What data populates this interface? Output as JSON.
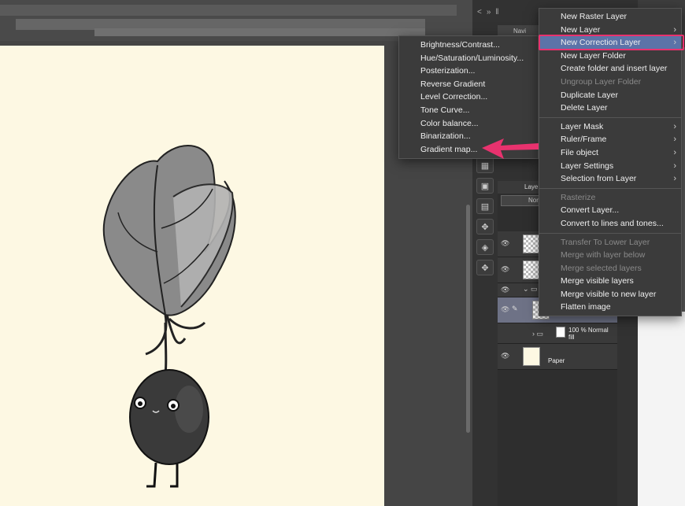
{
  "app": {
    "dock_tabs": [
      "<",
      "»",
      "‖"
    ],
    "navigator_tab": "Navi"
  },
  "layer_panel": {
    "header": "Laye",
    "blend_mode": "Nor",
    "layers": [
      {
        "name": "",
        "type": "raster"
      },
      {
        "name": "",
        "type": "raster"
      },
      {
        "name": "",
        "type": "folder"
      },
      {
        "name": "lineart",
        "type": "raster",
        "selected": true
      },
      {
        "name": "fill",
        "sub": "100 % Normal",
        "type": "folder"
      },
      {
        "name": "Paper",
        "type": "paper"
      }
    ]
  },
  "layer_menu": {
    "items": [
      {
        "label": "New Raster Layer",
        "enabled": true,
        "submenu": false
      },
      {
        "label": "New Layer",
        "enabled": true,
        "submenu": true
      },
      {
        "label": "New Correction Layer",
        "enabled": true,
        "submenu": true,
        "highlighted": true
      },
      {
        "label": "New Layer Folder",
        "enabled": true,
        "submenu": false
      },
      {
        "label": "Create folder and insert layer",
        "enabled": true,
        "submenu": false
      },
      {
        "label": "Ungroup Layer Folder",
        "enabled": false,
        "submenu": false
      },
      {
        "label": "Duplicate Layer",
        "enabled": true,
        "submenu": false
      },
      {
        "label": "Delete Layer",
        "enabled": true,
        "submenu": false
      },
      {
        "label": "Layer Mask",
        "enabled": true,
        "submenu": true
      },
      {
        "label": "Ruler/Frame",
        "enabled": true,
        "submenu": true
      },
      {
        "label": "File object",
        "enabled": true,
        "submenu": true
      },
      {
        "label": "Layer Settings",
        "enabled": true,
        "submenu": true
      },
      {
        "label": "Selection from Layer",
        "enabled": true,
        "submenu": true
      },
      {
        "label": "Rasterize",
        "enabled": false,
        "submenu": false
      },
      {
        "label": "Convert Layer...",
        "enabled": true,
        "submenu": false
      },
      {
        "label": "Convert to lines and tones...",
        "enabled": true,
        "submenu": false
      },
      {
        "label": "Transfer To Lower Layer",
        "enabled": false,
        "submenu": false
      },
      {
        "label": "Merge with layer below",
        "enabled": false,
        "submenu": false
      },
      {
        "label": "Merge selected layers",
        "enabled": false,
        "submenu": false
      },
      {
        "label": "Merge visible layers",
        "enabled": true,
        "submenu": false
      },
      {
        "label": "Merge visible to new layer",
        "enabled": true,
        "submenu": false
      },
      {
        "label": "Flatten image",
        "enabled": true,
        "submenu": false
      }
    ]
  },
  "correction_menu": {
    "items": [
      "Brightness/Contrast...",
      "Hue/Saturation/Luminosity...",
      "Posterization...",
      "Reverse Gradient",
      "Level Correction...",
      "Tone Curve...",
      "Color balance...",
      "Binarization...",
      "Gradient map..."
    ]
  },
  "colors": {
    "highlight_border": "#e8326e",
    "menu_highlight": "#5c73a8",
    "canvas_paper": "#fdf8e3",
    "menu_bg": "#3b3b3b"
  }
}
